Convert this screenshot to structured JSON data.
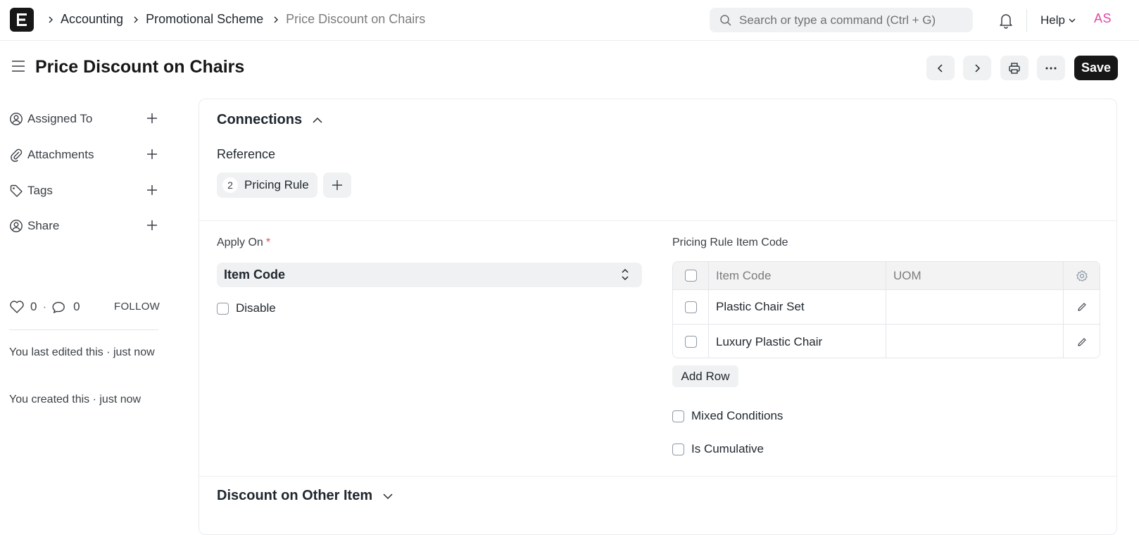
{
  "navbar": {
    "logo_letter": "E",
    "breadcrumbs": [
      "Accounting",
      "Promotional Scheme",
      "Price Discount on Chairs"
    ],
    "search_placeholder": "Search or type a command (Ctrl + G)",
    "help_label": "Help",
    "avatar_initials": "AS"
  },
  "page": {
    "title": "Price Discount on Chairs",
    "save_label": "Save"
  },
  "sidebar": {
    "items": [
      {
        "label": "Assigned To",
        "icon": "user-add-icon"
      },
      {
        "label": "Attachments",
        "icon": "paperclip-icon"
      },
      {
        "label": "Tags",
        "icon": "tag-icon"
      },
      {
        "label": "Share",
        "icon": "share-user-icon"
      }
    ],
    "likes_count": "0",
    "comments_count": "0",
    "follow_label": "FOLLOW",
    "last_edited": "You last edited this · just now",
    "created": "You created this · just now"
  },
  "connections": {
    "title": "Connections",
    "reference_label": "Reference",
    "references": [
      {
        "count": "2",
        "name": "Pricing Rule"
      }
    ]
  },
  "form": {
    "apply_on_label": "Apply On",
    "apply_on_required": "*",
    "apply_on_value": "Item Code",
    "disable_label": "Disable",
    "table_label": "Pricing Rule Item Code",
    "table_columns": [
      "Item Code",
      "UOM"
    ],
    "table_rows": [
      {
        "item_code": "Plastic Chair Set",
        "uom": ""
      },
      {
        "item_code": "Luxury Plastic Chair",
        "uom": ""
      }
    ],
    "add_row_label": "Add Row",
    "mixed_conditions_label": "Mixed Conditions",
    "is_cumulative_label": "Is Cumulative"
  },
  "discount_section": {
    "title": "Discount on Other Item"
  },
  "colors": {
    "brand_dark": "#171717",
    "avatar_pink": "#e048a9",
    "required_red": "#e24c4c",
    "muted_bg": "#f0f1f2"
  }
}
